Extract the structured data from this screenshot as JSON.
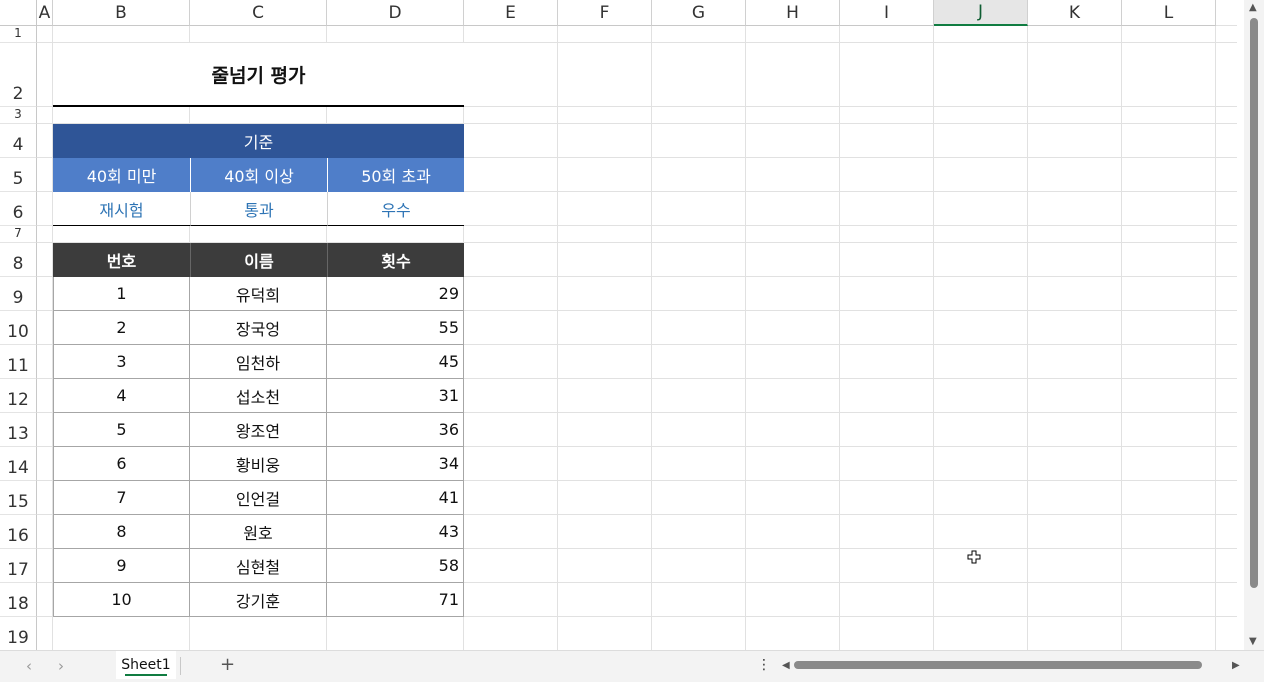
{
  "columns": [
    "A",
    "B",
    "C",
    "D",
    "E",
    "F",
    "G",
    "H",
    "I",
    "J",
    "K",
    "L"
  ],
  "selected_column": "J",
  "rows": [
    "1",
    "2",
    "3",
    "4",
    "5",
    "6",
    "7",
    "8",
    "9",
    "10",
    "11",
    "12",
    "13",
    "14",
    "15",
    "16",
    "17",
    "18",
    "19"
  ],
  "title": "줄넘기 평가",
  "criteria": {
    "header": "기준",
    "ranges": [
      "40회 미만",
      "40회 이상",
      "50회 초과"
    ],
    "results": [
      "재시험",
      "통과",
      "우수"
    ]
  },
  "table": {
    "headers": [
      "번호",
      "이름",
      "횟수"
    ],
    "rows": [
      [
        "1",
        "유덕희",
        "29"
      ],
      [
        "2",
        "장국엉",
        "55"
      ],
      [
        "3",
        "임천하",
        "45"
      ],
      [
        "4",
        "섭소천",
        "31"
      ],
      [
        "5",
        "왕조연",
        "36"
      ],
      [
        "6",
        "황비웅",
        "34"
      ],
      [
        "7",
        "인언걸",
        "41"
      ],
      [
        "8",
        "원호",
        "43"
      ],
      [
        "9",
        "심현철",
        "58"
      ],
      [
        "10",
        "강기훈",
        "71"
      ]
    ]
  },
  "sheet_tab": "Sheet1",
  "add_sheet": "+",
  "more": "⋮"
}
